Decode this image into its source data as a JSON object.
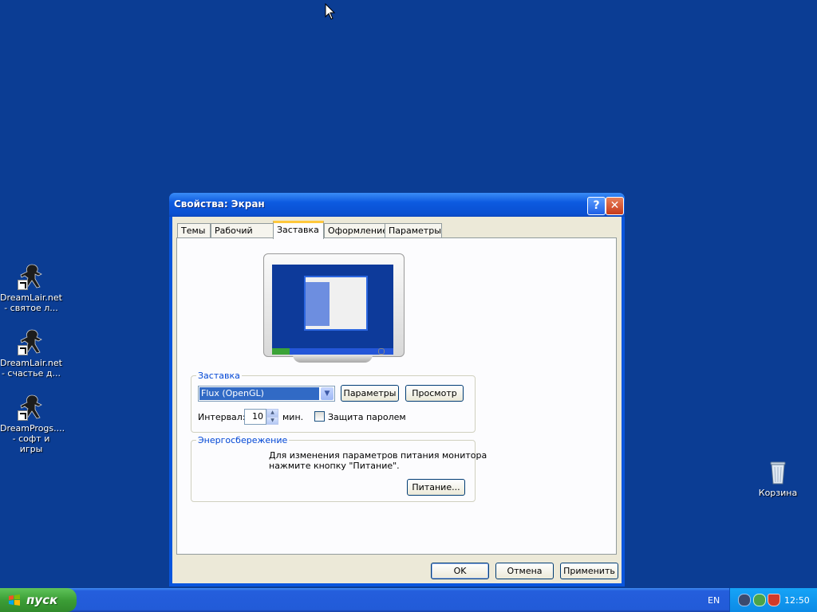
{
  "desktop": {
    "icons": [
      {
        "label_line1": "DreamLair.net",
        "label_line2": "- святое л..."
      },
      {
        "label_line1": "DreamLair.net",
        "label_line2": "- счастье д..."
      },
      {
        "label_line1": "DreamProgs....",
        "label_line2": "- софт и игры"
      }
    ],
    "recycle_bin": {
      "label": "Корзина"
    }
  },
  "dialog": {
    "title": "Свойства: Экран",
    "help_glyph": "?",
    "close_glyph": "✕",
    "tabs": [
      {
        "label": "Темы",
        "active": false
      },
      {
        "label": "Рабочий стол",
        "active": false
      },
      {
        "label": "Заставка",
        "active": true
      },
      {
        "label": "Оформление",
        "active": false
      },
      {
        "label": "Параметры",
        "active": false
      }
    ],
    "screensaver_group": {
      "label": "Заставка",
      "selected": "Flux (OpenGL)",
      "settings_button": "Параметры",
      "preview_button": "Просмотр",
      "interval_label": "Интервал:",
      "interval_value": "10",
      "minutes_label": "мин.",
      "password_label": "Защита паролем",
      "password_checked": false
    },
    "power_group": {
      "label": "Энергосбережение",
      "text_line1": "Для изменения параметров питания монитора",
      "text_line2": "нажмите кнопку \"Питание\".",
      "power_button": "Питание..."
    },
    "buttons": {
      "ok": "OK",
      "cancel": "Отмена",
      "apply": "Применить"
    }
  },
  "taskbar": {
    "start_label": "пуск",
    "language": "EN",
    "clock": "12:50"
  },
  "colors": {
    "desktop": "#0b3d94",
    "title_bar": "#0a4fd0",
    "dialog_face": "#ece9d8",
    "selection": "#316ac5",
    "groupbox_label": "#0046d5",
    "start_green": "#3c9e36"
  }
}
